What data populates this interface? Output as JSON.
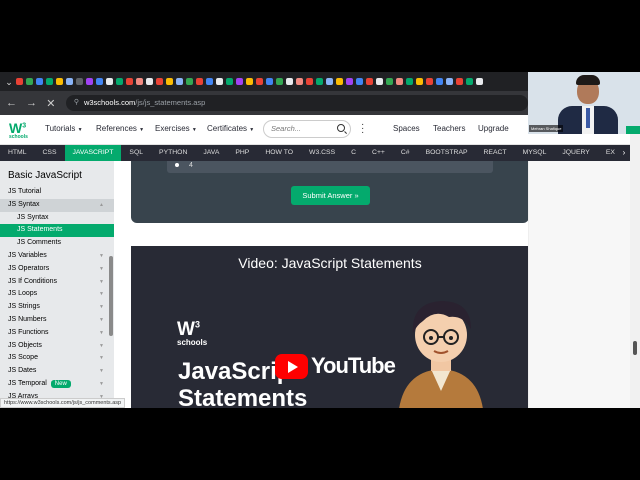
{
  "browser": {
    "url_host": "w3schools.com",
    "url_path": "/js/js_statements.asp",
    "status_url": "https://www.w3schools.com/js/js_comments.asp"
  },
  "webcam": {
    "name": "Mehran Shafique"
  },
  "topnav": {
    "menus": [
      "Tutorials",
      "References",
      "Exercises",
      "Certificates"
    ],
    "search_placeholder": "Search...",
    "links": [
      "Spaces",
      "Teachers",
      "Upgrade"
    ]
  },
  "langbar": {
    "items": [
      "HTML",
      "CSS",
      "JAVASCRIPT",
      "SQL",
      "PYTHON",
      "JAVA",
      "PHP",
      "HOW TO",
      "W3.CSS",
      "C",
      "C++",
      "C#",
      "BOOTSTRAP",
      "REACT",
      "MYSQL",
      "JQUERY",
      "EX"
    ],
    "active": "JAVASCRIPT"
  },
  "sidebar": {
    "title": "Basic JavaScript",
    "items": [
      {
        "label": "JS Tutorial"
      },
      {
        "label": "JS Syntax",
        "state": "open"
      },
      {
        "label": "JS Syntax",
        "sub": true
      },
      {
        "label": "JS Statements",
        "sub": true,
        "state": "active"
      },
      {
        "label": "JS Comments",
        "sub": true
      },
      {
        "label": "JS Variables"
      },
      {
        "label": "JS Operators"
      },
      {
        "label": "JS If Conditions"
      },
      {
        "label": "JS Loops"
      },
      {
        "label": "JS Strings"
      },
      {
        "label": "JS Numbers"
      },
      {
        "label": "JS Functions"
      },
      {
        "label": "JS Objects"
      },
      {
        "label": "JS Scope"
      },
      {
        "label": "JS Dates"
      },
      {
        "label": "JS Temporal",
        "badge": "New"
      },
      {
        "label": "JS Arrays"
      }
    ]
  },
  "exercise": {
    "option_number": "4",
    "submit_label": "Submit Answer »"
  },
  "video": {
    "title": "Video: JavaScript Statements",
    "logo_text": "schools",
    "thumb_line1": "JavaScript",
    "thumb_line2": "Statements",
    "youtube_label": "YouTube"
  }
}
